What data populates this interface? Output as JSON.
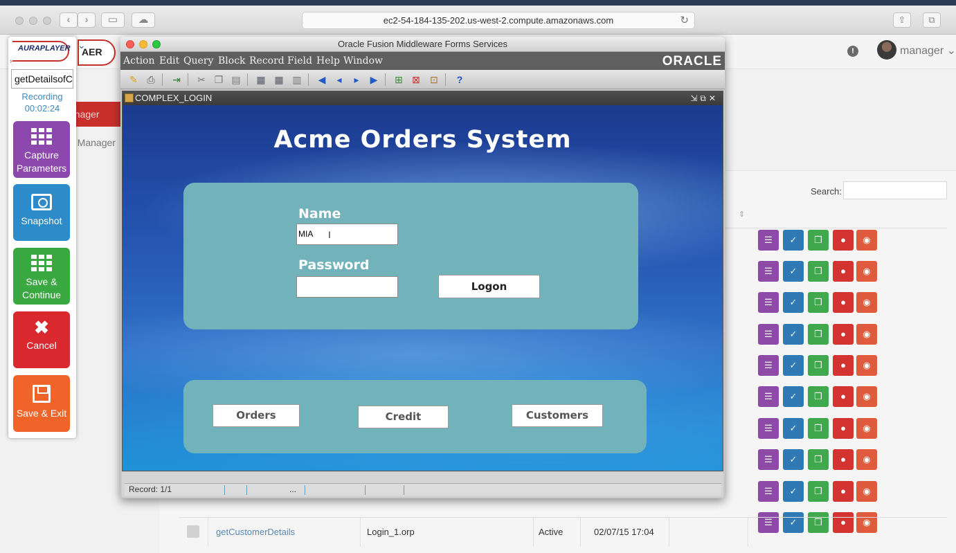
{
  "browser": {
    "url": "ec2-54-184-135-202.us-west-2.compute.amazonaws.com"
  },
  "webapp": {
    "user": "manager",
    "sidebar_active_label": "anager",
    "sidebar_item2_label": "e Manager",
    "search_label": "Search:",
    "table_row": {
      "name": "getCustomerDetails",
      "file": "Login_1.orp",
      "status": "Active",
      "date": "02/07/15 17:04"
    },
    "colors": {
      "view": "#8e4aa7",
      "check": "#2f7ab4",
      "copy": "#40a84d",
      "delete": "#d33432",
      "other": "#e05a3e"
    }
  },
  "recorder": {
    "logo_text": "AURAPLAYER",
    "service_name": "getDetailsofC",
    "status": "Recording",
    "timer": "00:02:24",
    "buttons": {
      "capture": "Capture Parameters",
      "snapshot": "Snapshot",
      "save_continue": "Save & Continue",
      "cancel": "Cancel",
      "save_exit": "Save & Exit"
    }
  },
  "oracle": {
    "window_title": "Oracle Fusion Middleware Forms Services",
    "brand": "ORACLE",
    "menu": [
      "Action",
      "Edit",
      "Query",
      "Block",
      "Record",
      "Field",
      "Help",
      "Window"
    ],
    "form_title": "COMPLEX_LOGIN",
    "app_title": "Acme Orders System",
    "name_label": "Name",
    "name_value": "MIA",
    "password_label": "Password",
    "password_value": "",
    "logon_label": "Logon",
    "nav_buttons": {
      "orders": "Orders",
      "credit": "Credit",
      "customers": "Customers"
    },
    "status_record": "Record: 1/1",
    "status_dots": "..."
  }
}
